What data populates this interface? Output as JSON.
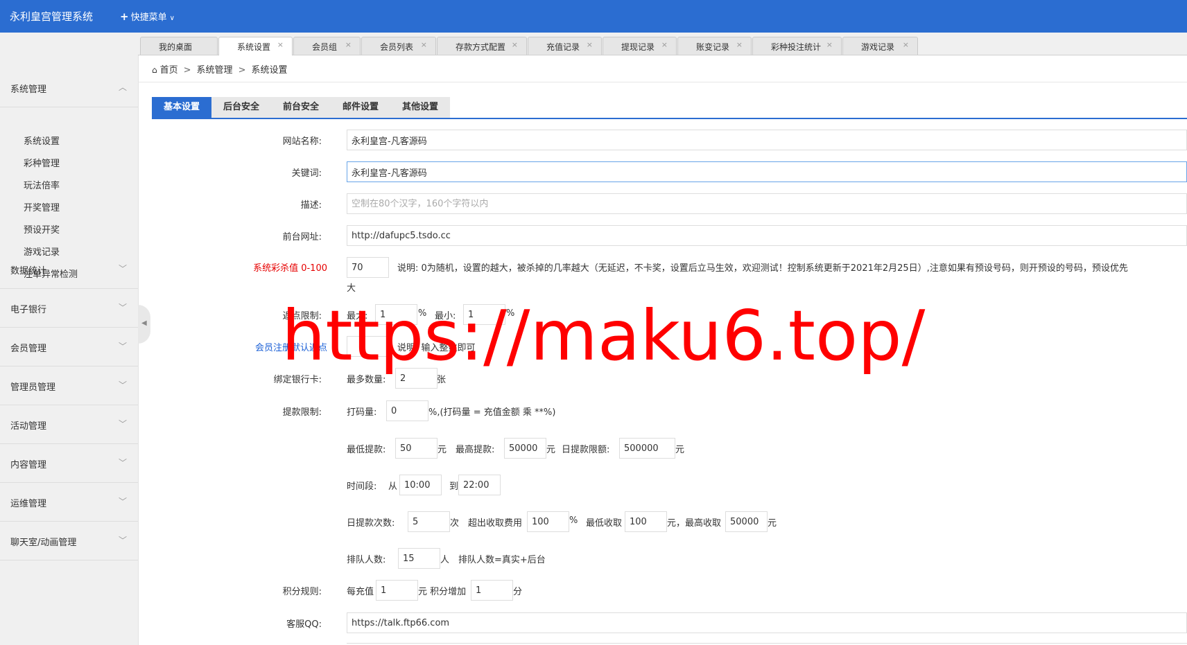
{
  "app": {
    "title": "永利皇宫管理系统",
    "quick_menu": "快捷菜单"
  },
  "colors": {
    "primary": "#2b6dd1",
    "danger": "#e60000",
    "link": "#1a5fd6",
    "watermark": "#ff0000"
  },
  "sidebar": {
    "groups": [
      {
        "label": "系统管理",
        "expanded": true
      },
      {
        "label": "数据统计"
      },
      {
        "label": "电子银行"
      },
      {
        "label": "会员管理"
      },
      {
        "label": "管理员管理"
      },
      {
        "label": "活动管理"
      },
      {
        "label": "内容管理"
      },
      {
        "label": "运维管理"
      },
      {
        "label": "聊天室/动画管理"
      }
    ],
    "sub_items": [
      "系统设置",
      "彩种管理",
      "玩法倍率",
      "开奖管理",
      "预设开奖",
      "游戏记录",
      "注单异常检测"
    ]
  },
  "tabs": [
    {
      "label": "我的桌面"
    },
    {
      "label": "系统设置",
      "active": true
    },
    {
      "label": "会员组"
    },
    {
      "label": "会员列表"
    },
    {
      "label": "存款方式配置"
    },
    {
      "label": "充值记录"
    },
    {
      "label": "提现记录"
    },
    {
      "label": "账变记录"
    },
    {
      "label": "彩种投注统计"
    },
    {
      "label": "游戏记录"
    }
  ],
  "tab_close": "×",
  "breadcrumb": {
    "items": [
      "首页",
      "系统管理",
      "系统设置"
    ],
    "sep": ">"
  },
  "subtabs": [
    "基本设置",
    "后台安全",
    "前台安全",
    "邮件设置",
    "其他设置"
  ],
  "form": {
    "site_name": {
      "label": "网站名称:",
      "value": "永利皇宫-凡客源码"
    },
    "keywords": {
      "label": "关键词:",
      "value": "永利皇宫-凡客源码"
    },
    "description": {
      "label": "描述:",
      "placeholder": "空制在80个汉字，160个字符以内"
    },
    "front_url": {
      "label": "前台网址:",
      "value": "http://dafupc5.tsdo.cc"
    },
    "kill_value": {
      "label": "系统彩杀值 0-100",
      "value": "70",
      "note": "说明:  0为随机，设置的越大，被杀掉的几率越大（无延迟，不卡奖，设置后立马生效，欢迎测试！控制系统更新于2021年2月25日）,注意如果有预设号码，则开预设的号码，预设优先",
      "note_wrap": "大"
    },
    "rebate": {
      "label": "返点限制:",
      "max_label": "最大:",
      "max": "1",
      "min_label": "最小:",
      "min": "1",
      "pct": "%"
    },
    "reg_rebate": {
      "label": "会员注册默认返点",
      "note": "说明:  输入整数即可"
    },
    "bind_card": {
      "label": "绑定银行卡:",
      "prefix": "最多数量:",
      "value": "2",
      "unit": "张"
    },
    "withdraw": {
      "label": "提款限制:",
      "bet_label": "打码量:",
      "bet": "0",
      "bet_note": "%,(打码量 = 充值金额 乘 **%)",
      "min_label": "最低提款:",
      "min": "50",
      "min_unit": "元",
      "max_label": "最高提款:",
      "max": "50000",
      "max_unit": "元",
      "daily_label": "日提款限额:",
      "daily": "500000",
      "daily_unit": "元",
      "time_label": "时间段:",
      "from_label": "从",
      "from": "10:00",
      "to_label": "到",
      "to": "22:00",
      "count_label": "日提款次数:",
      "count": "5",
      "count_unit": "次",
      "fee_label": "超出收取费用",
      "fee": "100",
      "fee_unit": "%",
      "fee_min_label": "最低收取",
      "fee_min": "100",
      "fee_min_unit": "元，最高收取",
      "fee_max": "50000",
      "fee_max_unit": "元",
      "queue_label": "排队人数:",
      "queue": "15",
      "queue_unit": "人",
      "queue_note": "排队人数=真实+后台"
    },
    "points": {
      "label": "积分规则:",
      "prefix": "每充值",
      "value": "1",
      "middle": "元 积分增加",
      "value2": "1",
      "suffix": "分"
    },
    "qq": {
      "label": "客服QQ:",
      "value": "https://talk.ftp66.com"
    }
  },
  "watermark": "https://maku6.top/"
}
